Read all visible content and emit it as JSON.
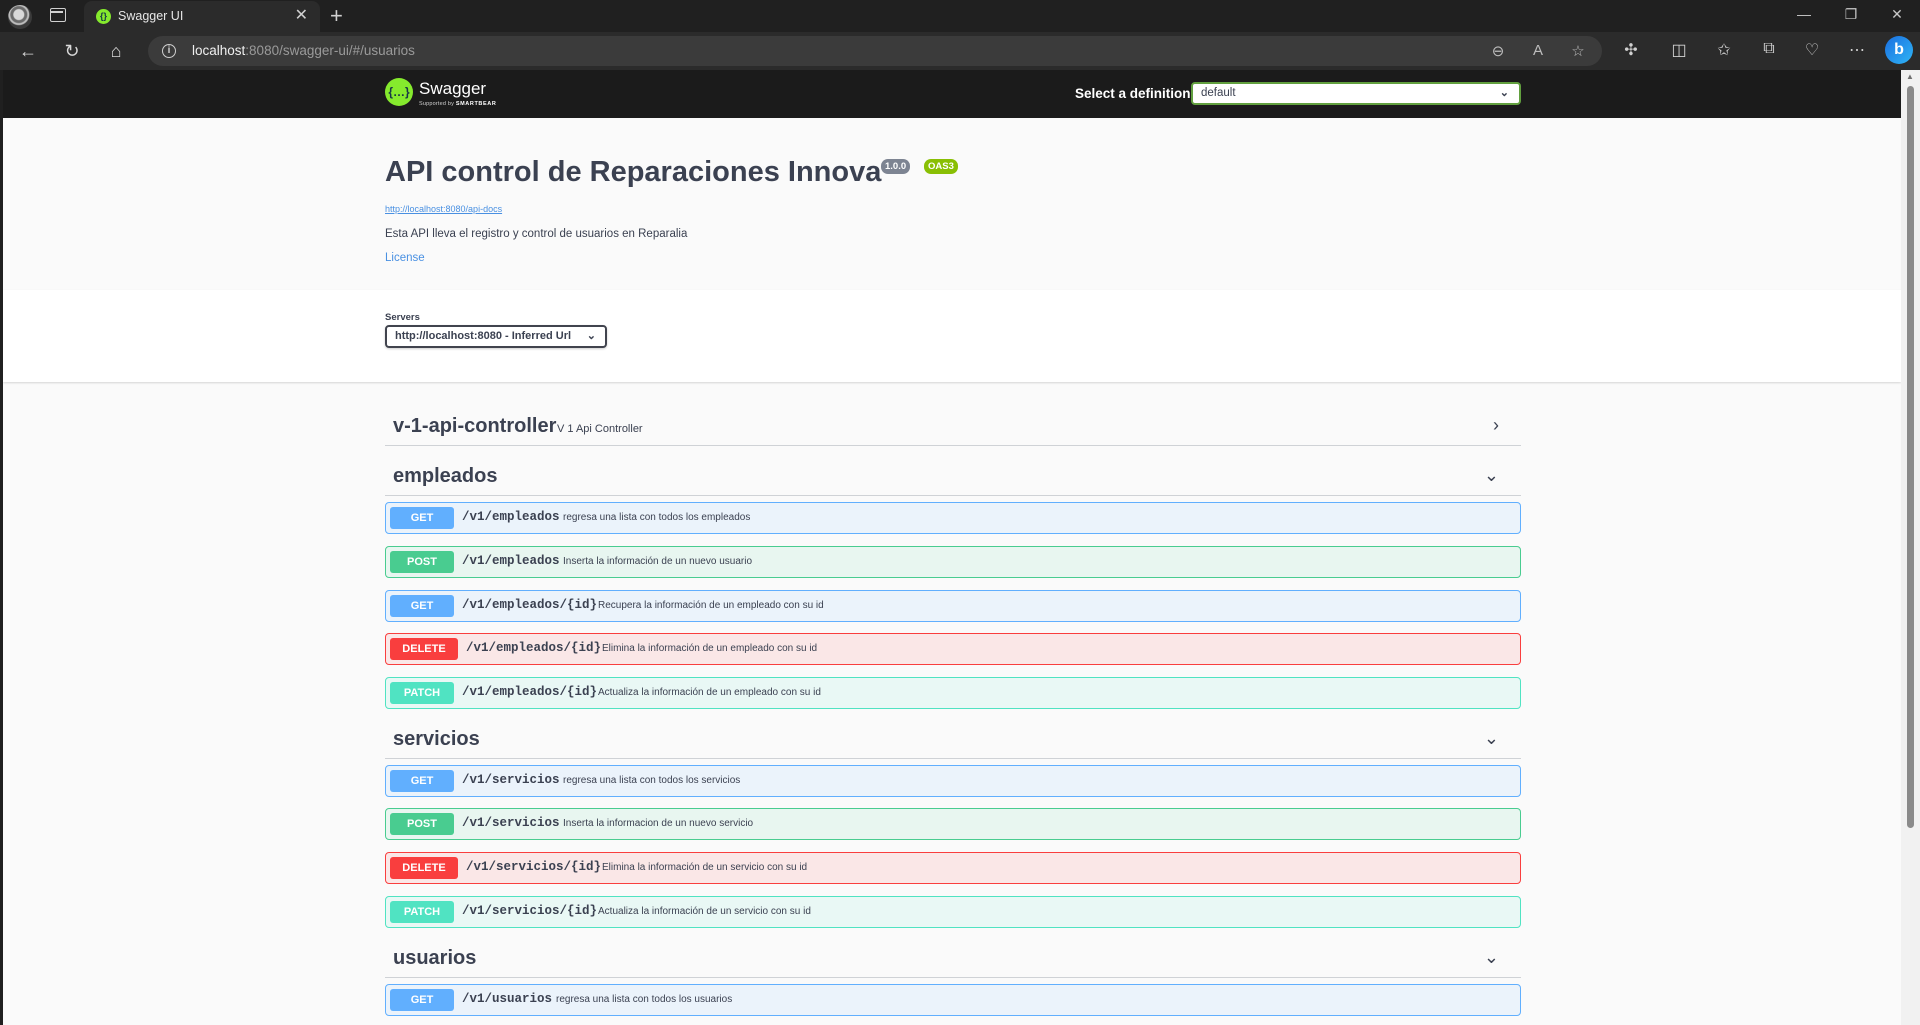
{
  "browser": {
    "tab_title": "Swagger UI",
    "url_host": "localhost",
    "url_rest": ":8080/swagger-ui/#/usuarios"
  },
  "swagger": {
    "brand": "Swagger",
    "sub_prefix": "Supported by",
    "sub_brand": "SMARTBEAR",
    "definition_label": "Select a definition",
    "definition_value": "default"
  },
  "info": {
    "title": "API control de Reparaciones Innova",
    "version": "1.0.0",
    "oas": "OAS3",
    "docs_url": "http://localhost:8080/api-docs",
    "description": "Esta API lleva el registro y control de usuarios en Reparalia",
    "license": "License"
  },
  "servers": {
    "label": "Servers",
    "selected": "http://localhost:8080 - Inferred Url"
  },
  "tags": [
    {
      "name": "v-1-api-controller",
      "description": "V 1 Api Controller",
      "expanded": false,
      "operations": []
    },
    {
      "name": "empleados",
      "description": "",
      "expanded": true,
      "operations": [
        {
          "method": "GET",
          "path": "/v1/empleados",
          "summary": "regresa una lista con todos los empleados"
        },
        {
          "method": "POST",
          "path": "/v1/empleados",
          "summary": "Inserta la información de un nuevo usuario"
        },
        {
          "method": "GET",
          "path": "/v1/empleados/{id}",
          "summary": "Recupera la información de un empleado con su id"
        },
        {
          "method": "DELETE",
          "path": "/v1/empleados/{id}",
          "summary": "Elimina la información de un empleado con su id"
        },
        {
          "method": "PATCH",
          "path": "/v1/empleados/{id}",
          "summary": "Actualiza la información de un empleado con su id"
        }
      ]
    },
    {
      "name": "servicios",
      "description": "",
      "expanded": true,
      "operations": [
        {
          "method": "GET",
          "path": "/v1/servicios",
          "summary": "regresa una lista con todos los servicios"
        },
        {
          "method": "POST",
          "path": "/v1/servicios",
          "summary": "Inserta la informacion de un nuevo servicio"
        },
        {
          "method": "DELETE",
          "path": "/v1/servicios/{id}",
          "summary": "Elimina la información de un servicio con su id"
        },
        {
          "method": "PATCH",
          "path": "/v1/servicios/{id}",
          "summary": "Actualiza la información de un servicio con su id"
        }
      ]
    },
    {
      "name": "usuarios",
      "description": "",
      "expanded": true,
      "operations": [
        {
          "method": "GET",
          "path": "/v1/usuarios",
          "summary": "regresa una lista con todos los usuarios"
        }
      ]
    }
  ],
  "colors": {
    "get": "#61affe",
    "post": "#49cc90",
    "delete": "#f93e3e",
    "patch": "#50e3c2",
    "swagger_green": "#85ea2d"
  }
}
